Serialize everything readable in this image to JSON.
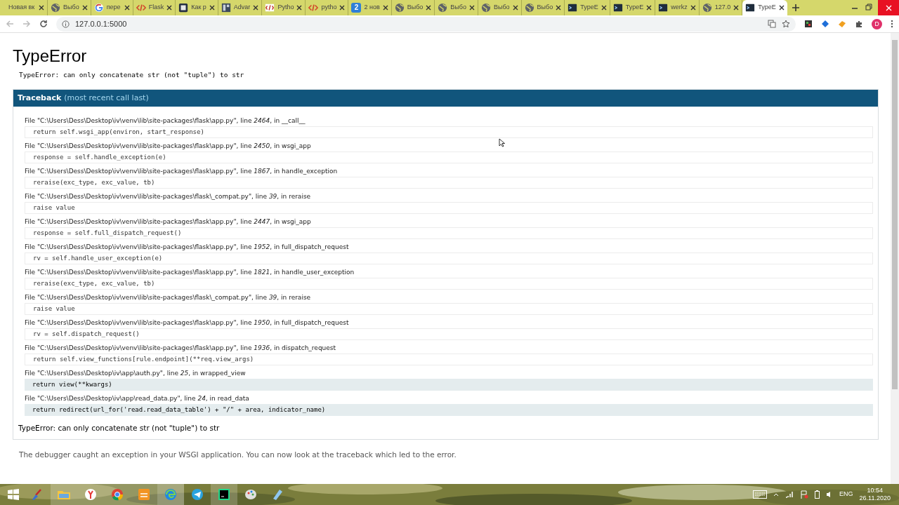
{
  "browser": {
    "tabs": [
      {
        "title": "Новая вк",
        "kind": "none",
        "selected": false
      },
      {
        "title": "Выбо",
        "kind": "globe",
        "selected": false
      },
      {
        "title": "пере",
        "kind": "google",
        "selected": false
      },
      {
        "title": "Flask",
        "kind": "code",
        "selected": false
      },
      {
        "title": "Как р",
        "kind": "square",
        "selected": false
      },
      {
        "title": "Advar",
        "kind": "grid",
        "selected": false
      },
      {
        "title": "Pytho",
        "kind": "tag",
        "selected": false
      },
      {
        "title": "pytho",
        "kind": "code",
        "selected": false
      },
      {
        "title": "2 нов",
        "kind": "badge",
        "badge": "2",
        "selected": false
      },
      {
        "title": "Выбо",
        "kind": "globe",
        "selected": false
      },
      {
        "title": "Выбо",
        "kind": "globe",
        "selected": false
      },
      {
        "title": "Выбо",
        "kind": "globe",
        "selected": false
      },
      {
        "title": "Выбо",
        "kind": "globe",
        "selected": false
      },
      {
        "title": "TypeE",
        "kind": "terminal",
        "selected": false
      },
      {
        "title": "TypeE",
        "kind": "terminal",
        "selected": false
      },
      {
        "title": "werkz",
        "kind": "terminal",
        "selected": false
      },
      {
        "title": "127.0",
        "kind": "globe",
        "selected": false
      },
      {
        "title": "TypeE",
        "kind": "terminal",
        "selected": true
      }
    ],
    "url": "127.0.0.1:5000",
    "profile_initial": "D"
  },
  "page": {
    "title": "TypeError",
    "message": "TypeError: can only concatenate str (not \"tuple\") to str",
    "traceback_heading": "Traceback",
    "traceback_note": "(most recent call last)",
    "frames": [
      {
        "location": "File \"C:\\Users\\Dess\\Desktop\\iv\\venv\\lib\\site-packages\\flask\\app.py\", line *2464*, in __call__",
        "code": "return self.wsgi_app(environ, start_response)",
        "in_app": false
      },
      {
        "location": "File \"C:\\Users\\Dess\\Desktop\\iv\\venv\\lib\\site-packages\\flask\\app.py\", line *2450*, in wsgi_app",
        "code": "response = self.handle_exception(e)",
        "in_app": false
      },
      {
        "location": "File \"C:\\Users\\Dess\\Desktop\\iv\\venv\\lib\\site-packages\\flask\\app.py\", line *1867*, in handle_exception",
        "code": "reraise(exc_type, exc_value, tb)",
        "in_app": false
      },
      {
        "location": "File \"C:\\Users\\Dess\\Desktop\\iv\\venv\\lib\\site-packages\\flask\\_compat.py\", line *39*, in reraise",
        "code": "raise value",
        "in_app": false
      },
      {
        "location": "File \"C:\\Users\\Dess\\Desktop\\iv\\venv\\lib\\site-packages\\flask\\app.py\", line *2447*, in wsgi_app",
        "code": "response = self.full_dispatch_request()",
        "in_app": false
      },
      {
        "location": "File \"C:\\Users\\Dess\\Desktop\\iv\\venv\\lib\\site-packages\\flask\\app.py\", line *1952*, in full_dispatch_request",
        "code": "rv = self.handle_user_exception(e)",
        "in_app": false
      },
      {
        "location": "File \"C:\\Users\\Dess\\Desktop\\iv\\venv\\lib\\site-packages\\flask\\app.py\", line *1821*, in handle_user_exception",
        "code": "reraise(exc_type, exc_value, tb)",
        "in_app": false
      },
      {
        "location": "File \"C:\\Users\\Dess\\Desktop\\iv\\venv\\lib\\site-packages\\flask\\_compat.py\", line *39*, in reraise",
        "code": "raise value",
        "in_app": false
      },
      {
        "location": "File \"C:\\Users\\Dess\\Desktop\\iv\\venv\\lib\\site-packages\\flask\\app.py\", line *1950*, in full_dispatch_request",
        "code": "rv = self.dispatch_request()",
        "in_app": false
      },
      {
        "location": "File \"C:\\Users\\Dess\\Desktop\\iv\\venv\\lib\\site-packages\\flask\\app.py\", line *1936*, in dispatch_request",
        "code": "return self.view_functions[rule.endpoint](**req.view_args)",
        "in_app": false
      },
      {
        "location": "File \"C:\\Users\\Dess\\Desktop\\iv\\app\\auth.py\", line *25*, in wrapped_view",
        "code": "return view(**kwargs)",
        "in_app": true
      },
      {
        "location": "File \"C:\\Users\\Dess\\Desktop\\iv\\app\\read_data.py\", line *24*, in read_data",
        "code": "return redirect(url_for('read.read_data_table') + \"/\" + area, indicator_name)",
        "in_app": true
      }
    ],
    "footer_error": "TypeError: can only concatenate str (not \"tuple\") to str",
    "explanation": "The debugger caught an exception in your WSGI application. You can now look at the traceback which led to the error."
  },
  "taskbar": {
    "language": "ENG",
    "time": "10:54",
    "date": "26.11.2020"
  }
}
